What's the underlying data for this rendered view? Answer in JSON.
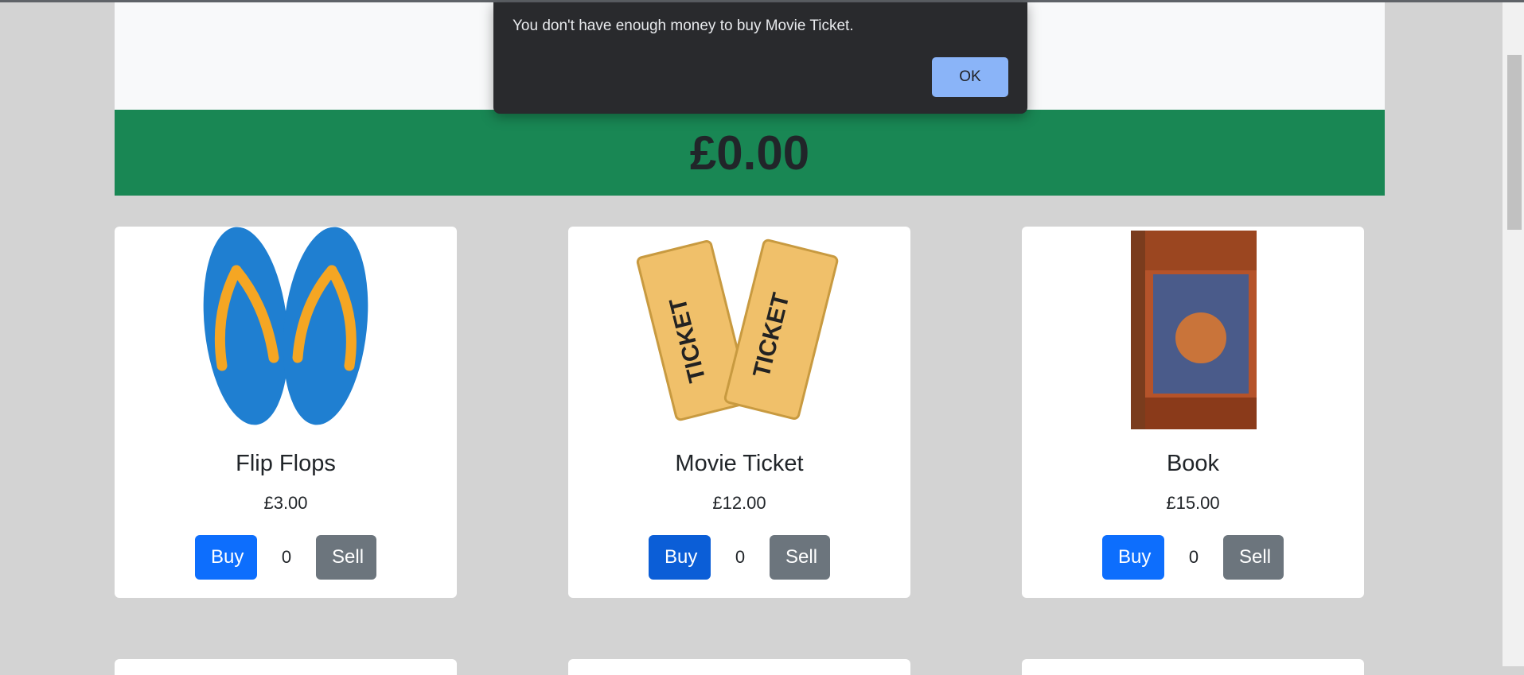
{
  "dialog": {
    "message": "You don't have enough money to buy Movie Ticket.",
    "ok_label": "OK"
  },
  "balance": "£0.00",
  "products": [
    {
      "name": "Flip Flops",
      "price": "£3.00",
      "quantity": "0",
      "buy_label": "Buy",
      "sell_label": "Sell",
      "image": "flip-flops"
    },
    {
      "name": "Movie Ticket",
      "price": "£12.00",
      "quantity": "0",
      "buy_label": "Buy",
      "sell_label": "Sell",
      "image": "movie-ticket"
    },
    {
      "name": "Book",
      "price": "£15.00",
      "quantity": "0",
      "buy_label": "Buy",
      "sell_label": "Sell",
      "image": "harry-potter-book"
    }
  ],
  "colors": {
    "balance_banner": "#198754",
    "buy": "#0d6efd",
    "sell": "#6c757d",
    "dialog_bg": "#292a2d",
    "ok_button": "#8ab4f8"
  }
}
